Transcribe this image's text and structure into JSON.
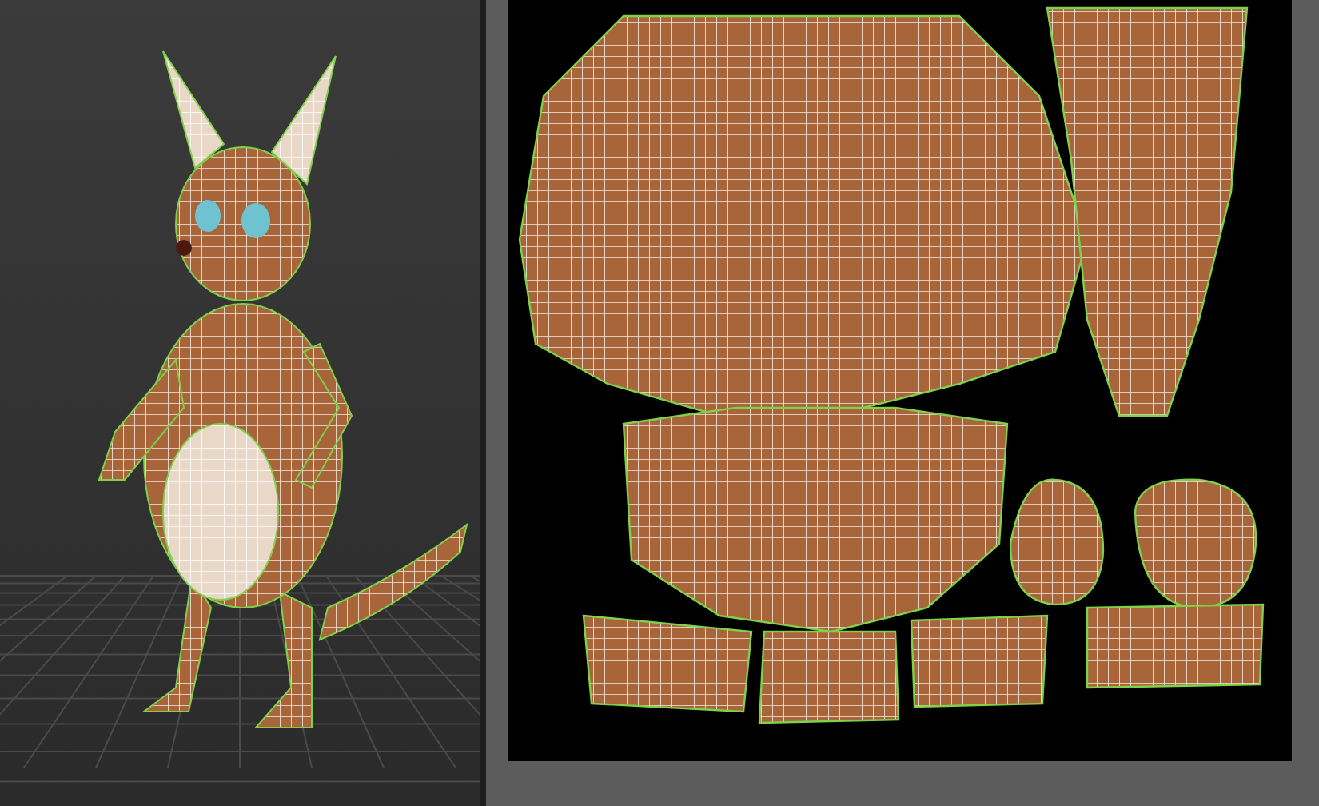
{
  "panels": [
    {
      "kind": "viewport"
    },
    {
      "kind": "uv_editor"
    }
  ]
}
